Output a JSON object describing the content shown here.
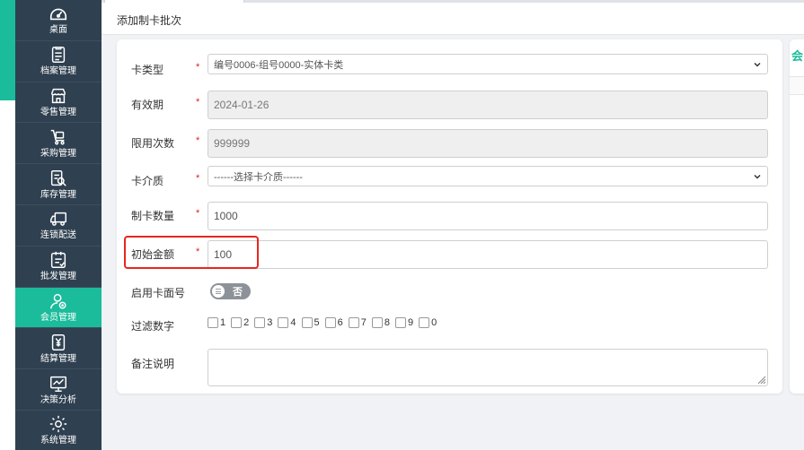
{
  "sidebar": {
    "items": [
      {
        "label": "桌面",
        "icon": "dashboard-icon",
        "active": false
      },
      {
        "label": "档案管理",
        "icon": "archive-icon",
        "active": false
      },
      {
        "label": "零售管理",
        "icon": "store-icon",
        "active": false
      },
      {
        "label": "采购管理",
        "icon": "cart-icon",
        "active": false
      },
      {
        "label": "库存管理",
        "icon": "inventory-icon",
        "active": false
      },
      {
        "label": "连锁配送",
        "icon": "truck-icon",
        "active": false
      },
      {
        "label": "批发管理",
        "icon": "wholesale-icon",
        "active": false
      },
      {
        "label": "会员管理",
        "icon": "member-icon",
        "active": true
      },
      {
        "label": "结算管理",
        "icon": "settlement-icon",
        "active": false
      },
      {
        "label": "决策分析",
        "icon": "analytics-icon",
        "active": false
      },
      {
        "label": "系统管理",
        "icon": "gear-icon",
        "active": false
      }
    ]
  },
  "header": {
    "title": "添加制卡批次"
  },
  "form": {
    "card_type": {
      "label": "卡类型",
      "required_mark": "*",
      "value": "编号0006-组号0000-实体卡类"
    },
    "validity": {
      "label": "有效期",
      "required_mark": "*",
      "value": "2024-01-26"
    },
    "use_limit": {
      "label": "限用次数",
      "required_mark": "*",
      "value": "999999"
    },
    "card_medium": {
      "label": "卡介质",
      "required_mark": "*",
      "value": "------选择卡介质------"
    },
    "card_count": {
      "label": "制卡数量",
      "required_mark": "*",
      "value": "1000"
    },
    "initial_amount": {
      "label": "初始金额",
      "required_mark": "*",
      "value": "100"
    },
    "enable_card_number": {
      "label": "启用卡面号",
      "toggle_text": "否",
      "enabled": false
    },
    "filter_digits": {
      "label": "过滤数字",
      "options": [
        "1",
        "2",
        "3",
        "4",
        "5",
        "6",
        "7",
        "8",
        "9",
        "0"
      ]
    },
    "remark": {
      "label": "备注说明",
      "value": ""
    }
  },
  "right_panel": {
    "title": "会"
  },
  "colors": {
    "accent": "#1bbc9b",
    "sidebar": "#2f4050",
    "highlight": "#e8261f",
    "required": "#e02020"
  }
}
